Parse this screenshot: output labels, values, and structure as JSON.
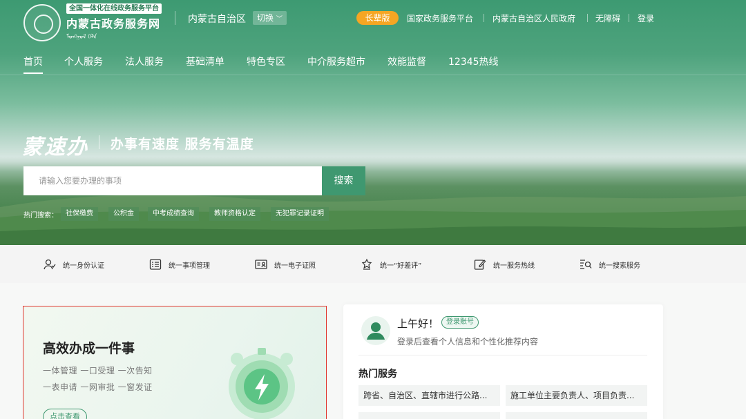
{
  "header": {
    "logo_tag": "全国一体化在线政务服务平台",
    "logo_title": "内蒙古政务服务网",
    "logo_mongol": "ᠮᠣᠩᠭᠣᠯ",
    "region": "内蒙古自治区",
    "switch_label": "切换",
    "elder_label": "长辈版",
    "links": [
      "国家政务服务平台",
      "内蒙古自治区人民政府",
      "无障碍",
      "登录"
    ]
  },
  "nav": {
    "items": [
      "首页",
      "个人服务",
      "法人服务",
      "基础清单",
      "特色专区",
      "中介服务超市",
      "效能监督",
      "12345热线"
    ]
  },
  "hero": {
    "slogan_logo": "蒙速办",
    "slogan": "办事有速度  服务有温度",
    "search_placeholder": "请输入您要办理的事项",
    "search_button": "搜索",
    "hot_label": "热门搜索：",
    "hot_tags": [
      "社保缴费",
      "公积金",
      "中考成绩查询",
      "教师资格认定",
      "无犯罪记录证明"
    ]
  },
  "features": [
    {
      "icon": "identity-icon",
      "label": "统一身份认证"
    },
    {
      "icon": "checklist-icon",
      "label": "统一事项管理"
    },
    {
      "icon": "id-card-icon",
      "label": "统一电子证照"
    },
    {
      "icon": "rating-icon",
      "label": "统一“好差评”"
    },
    {
      "icon": "edit-icon",
      "label": "统一服务热线"
    },
    {
      "icon": "search-list-icon",
      "label": "统一搜索服务"
    }
  ],
  "card_left": {
    "title": "高效办成一件事",
    "line1": "一体管理 一口受理 一次告知",
    "line2": "一表申请 一网审批 一窗发证",
    "button": "点击查看"
  },
  "card_right": {
    "greeting": "上午好！",
    "login_pill": "登录账号",
    "sub": "登录后查看个人信息和个性化推荐内容",
    "hot_title": "热门服务",
    "services": [
      "跨省、自治区、直辖市进行公路...",
      "施工单位主要负责人、项目负责...",
      "",
      ""
    ]
  },
  "colors": {
    "brand": "#3f9870",
    "elder": "#f5a623",
    "highlight_border": "#e0352d"
  }
}
